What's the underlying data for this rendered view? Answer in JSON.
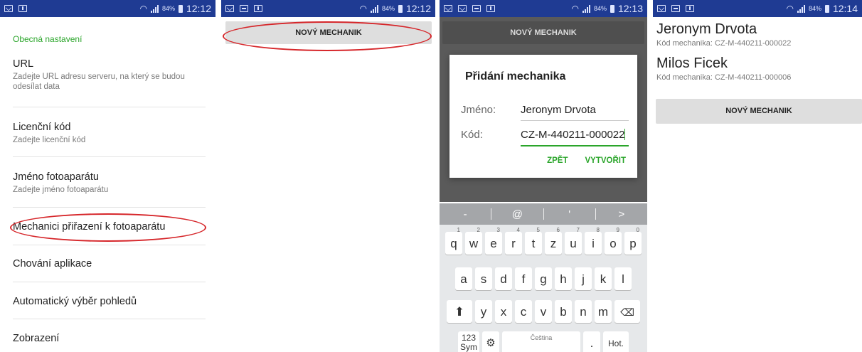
{
  "status_bars": [
    {
      "battery": "84%",
      "time": "12:12"
    },
    {
      "battery": "84%",
      "time": "12:12"
    },
    {
      "battery": "84%",
      "time": "12:13"
    },
    {
      "battery": "84%",
      "time": "12:14"
    }
  ],
  "settings": {
    "category": "Obecná nastavení",
    "items": [
      {
        "title": "URL",
        "subtitle": "Zadejte URL adresu serveru, na který se budou odesílat data"
      },
      {
        "title": "Licenční kód",
        "subtitle": "Zadejte licenční kód"
      },
      {
        "title": "Jméno fotoaparátu",
        "subtitle": "Zadejte jméno fotoaparátu"
      },
      {
        "title": "Mechanici přiřazení k fotoaparátu"
      },
      {
        "title": "Chování aplikace"
      },
      {
        "title": "Automatický výběr pohledů"
      },
      {
        "title": "Zobrazení"
      }
    ]
  },
  "new_mechanic_label": "NOVÝ MECHANIK",
  "dialog": {
    "title": "Přidání mechanika",
    "name_label": "Jméno:",
    "name_value": "Jeronym Drvota",
    "code_label": "Kód:",
    "code_value": "CZ-M-440211-000022",
    "back_label": "ZPĚT",
    "create_label": "VYTVOŘIT"
  },
  "keyboard": {
    "top_row": [
      "-",
      "@",
      "'",
      ">"
    ],
    "row1": [
      [
        "q",
        "1"
      ],
      [
        "w",
        "2"
      ],
      [
        "e",
        "3"
      ],
      [
        "r",
        "4"
      ],
      [
        "t",
        "5"
      ],
      [
        "z",
        "6"
      ],
      [
        "u",
        "7"
      ],
      [
        "i",
        "8"
      ],
      [
        "o",
        "9"
      ],
      [
        "p",
        "0"
      ]
    ],
    "row2": [
      "a",
      "s",
      "d",
      "f",
      "g",
      "h",
      "j",
      "k",
      "l"
    ],
    "row3": [
      "y",
      "x",
      "c",
      "v",
      "b",
      "n",
      "m"
    ],
    "symbols_label": "123 Sym",
    "language_label": "Čeština",
    "enter_label": "Hot."
  },
  "mechanics": [
    {
      "name": "Jeronym Drvota",
      "code_label": "Kód mechanika:",
      "code": "CZ-M-440211-000022"
    },
    {
      "name": "Milos Ficek",
      "code_label": "Kód mechanika:",
      "code": "CZ-M-440211-000006"
    }
  ],
  "colors": {
    "status_bar": "#1f3b93",
    "accent_green": "#2aa52a",
    "highlight_oval": "#d6262a"
  }
}
